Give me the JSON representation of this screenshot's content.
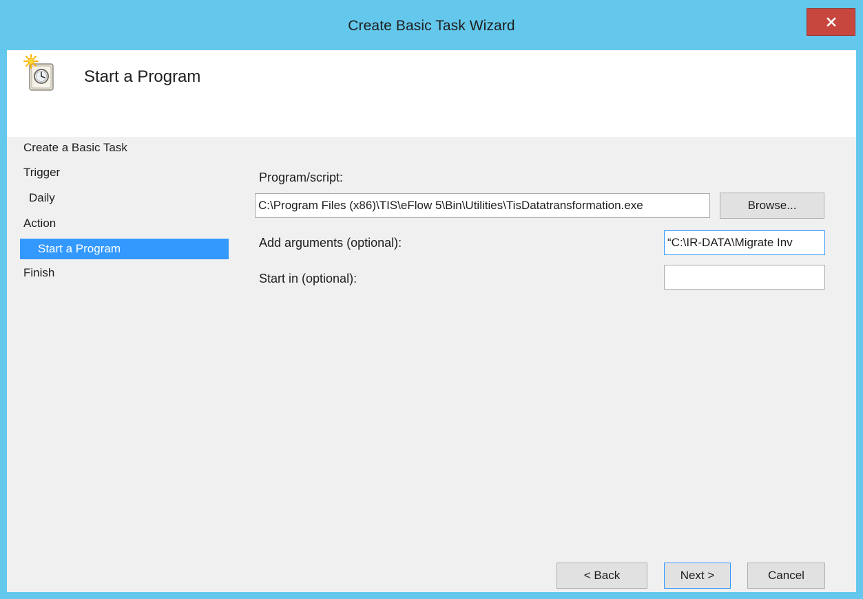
{
  "window": {
    "title": "Create Basic Task Wizard",
    "close_label": "x"
  },
  "header": {
    "title": "Start a Program",
    "icon": "scheduled-task-clock-icon"
  },
  "nav": {
    "items": [
      {
        "label": "Create a Basic Task",
        "selected": false
      },
      {
        "label": "Trigger",
        "selected": false
      },
      {
        "label": "Daily",
        "selected": false
      },
      {
        "label": "Action",
        "selected": false
      },
      {
        "label": "Start a Program",
        "selected": true
      },
      {
        "label": "Finish",
        "selected": false
      }
    ]
  },
  "form": {
    "program_label": "Program/script:",
    "program_value": "C:\\Program Files (x86)\\TIS\\eFlow 5\\Bin\\Utilities\\TisDatatransformation.exe",
    "browse_label": "Browse...",
    "arguments_label": "Add arguments (optional):",
    "arguments_value": "“C:\\IR-DATA\\Migrate Inv",
    "startin_label": "Start in (optional):",
    "startin_value": ""
  },
  "footer": {
    "back_label": "< Back",
    "next_label": "Next >",
    "cancel_label": "Cancel"
  },
  "colors": {
    "titlebar": "#63c8ec",
    "close": "#c7463d",
    "selection": "#3399ff"
  }
}
